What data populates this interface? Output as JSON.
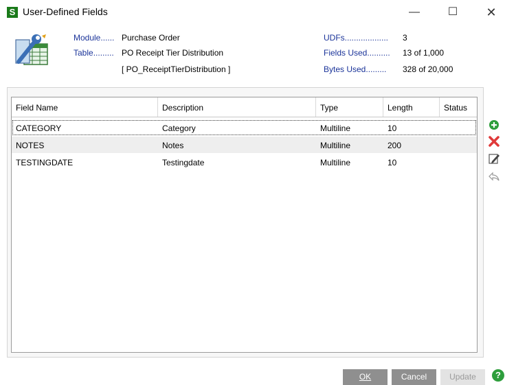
{
  "window": {
    "title": "User-Defined Fields",
    "app_icon_letter": "S",
    "minimize_glyph": "—",
    "maximize_glyph": "☐",
    "close_glyph": "✕"
  },
  "info": {
    "module_label": "Module......",
    "module_value": "Purchase Order",
    "table_label": "Table.........",
    "table_value": "PO Receipt Tier Distribution",
    "table_name": "[ PO_ReceiptTierDistribution ]",
    "udfs_label": "UDFs...................",
    "udfs_value": "3",
    "fields_used_label": "Fields Used..........",
    "fields_used_value": "13 of 1,000",
    "bytes_used_label": "Bytes Used.........",
    "bytes_used_value": "328 of 20,000"
  },
  "grid": {
    "columns": [
      "Field Name",
      "Description",
      "Type",
      "Length",
      "Status"
    ],
    "rows": [
      {
        "field_name": "CATEGORY",
        "description": "Category",
        "type": "Multiline",
        "length": "10",
        "status": ""
      },
      {
        "field_name": "NOTES",
        "description": "Notes",
        "type": "Multiline",
        "length": "200",
        "status": ""
      },
      {
        "field_name": "TESTINGDATE",
        "description": "Testingdate",
        "type": "Multiline",
        "length": "10",
        "status": ""
      }
    ]
  },
  "side_toolbar": {
    "icons": [
      "add-icon",
      "delete-icon",
      "edit-icon",
      "undo-icon"
    ]
  },
  "buttons": {
    "ok": "OK",
    "cancel": "Cancel",
    "update": "Update",
    "help": "?"
  },
  "colors": {
    "label_blue": "#1a3399",
    "button_gray": "#8f8f8f",
    "help_green": "#2e9e3c",
    "add_green": "#2e9e3c",
    "delete_red": "#e03a3a"
  }
}
